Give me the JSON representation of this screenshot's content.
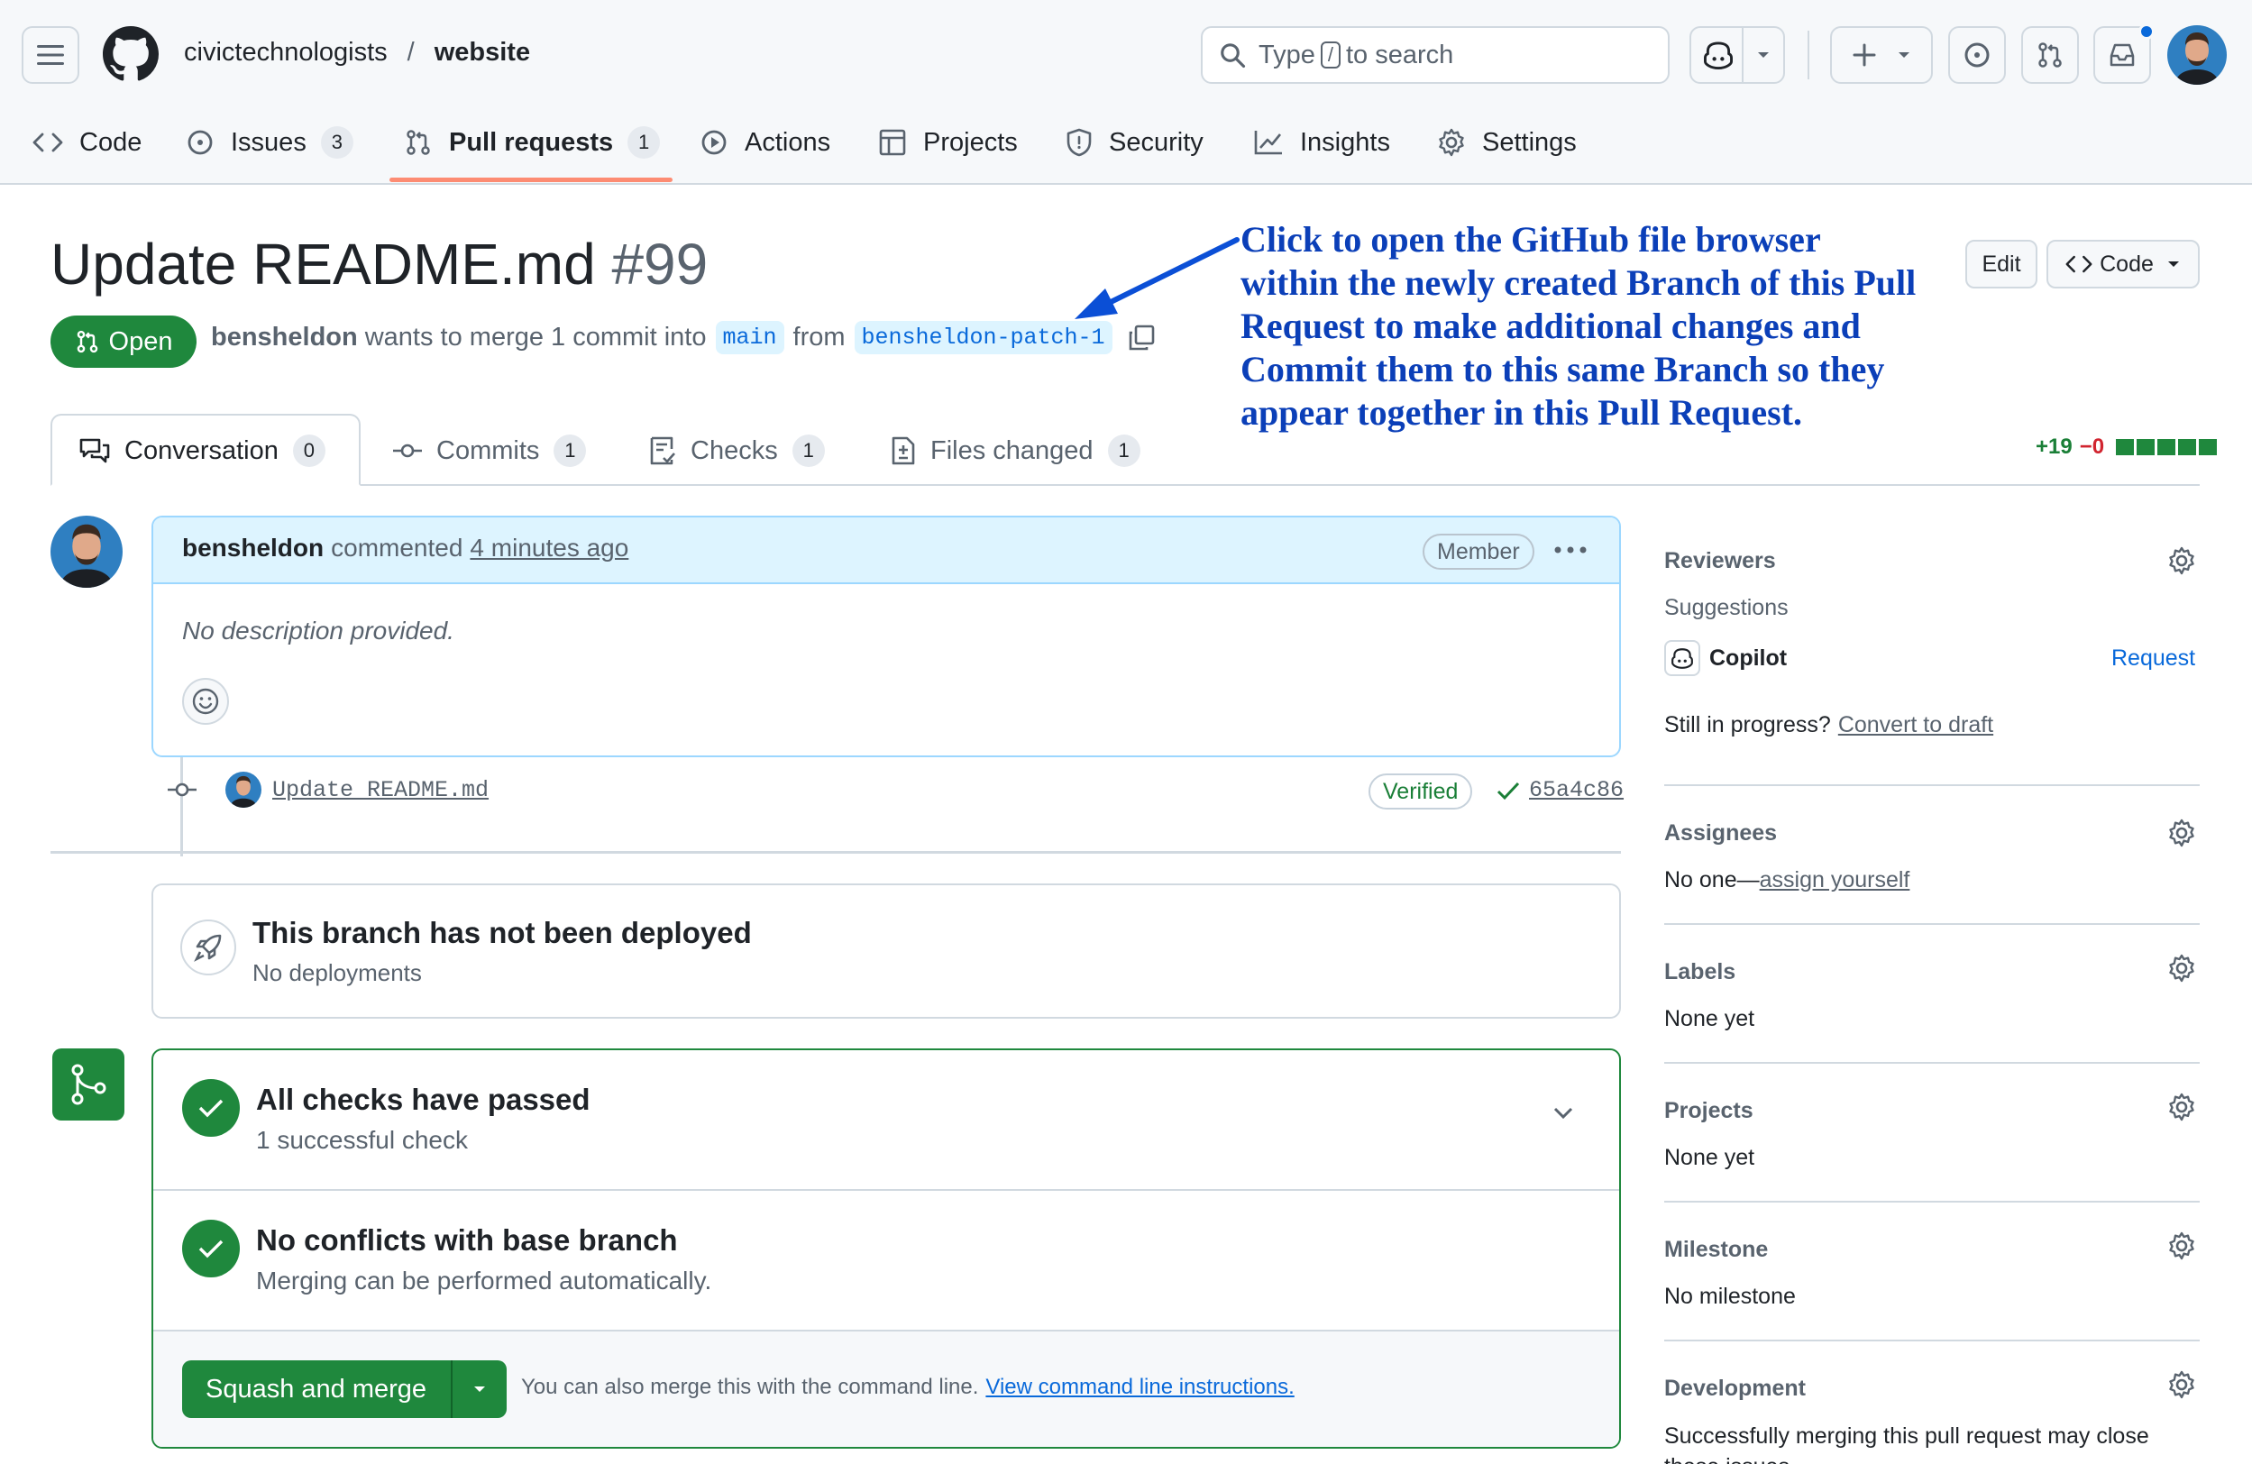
{
  "header": {
    "owner": "civictechnologists",
    "separator": "/",
    "repo": "website",
    "search": {
      "prefix": "Type",
      "key": "/",
      "suffix": "to search"
    }
  },
  "repo_nav": [
    {
      "label": "Code",
      "icon": "code-icon"
    },
    {
      "label": "Issues",
      "count": "3",
      "icon": "issue-icon"
    },
    {
      "label": "Pull requests",
      "count": "1",
      "icon": "pull-request-icon",
      "selected": true
    },
    {
      "label": "Actions",
      "icon": "play-icon"
    },
    {
      "label": "Projects",
      "icon": "table-icon"
    },
    {
      "label": "Security",
      "icon": "shield-icon"
    },
    {
      "label": "Insights",
      "icon": "graph-icon"
    },
    {
      "label": "Settings",
      "icon": "gear-icon"
    }
  ],
  "pr": {
    "title": "Update README.md",
    "number": "#99",
    "state": "Open",
    "author": "bensheldon",
    "merge_text": "wants to merge 1 commit into",
    "base": "main",
    "from_text": "from",
    "head": "bensheldon-patch-1",
    "edit_label": "Edit",
    "code_label": "Code"
  },
  "annotation": "Click to open the GitHub file browser within the newly created Branch of this Pull Request to make additional changes and Commit them to this same Branch so they appear together in this Pull Request.",
  "tabs": [
    {
      "label": "Conversation",
      "count": "0",
      "icon": "comment-discussion-icon"
    },
    {
      "label": "Commits",
      "count": "1",
      "icon": "git-commit-icon"
    },
    {
      "label": "Checks",
      "count": "1",
      "icon": "checklist-icon"
    },
    {
      "label": "Files changed",
      "count": "1",
      "icon": "file-diff-icon"
    }
  ],
  "diffstat": {
    "additions": "+19",
    "deletions": "−0"
  },
  "comment": {
    "author": "bensheldon",
    "action": "commented",
    "time": "4 minutes ago",
    "badge": "Member",
    "body": "No description provided."
  },
  "commit": {
    "message": "Update README.md",
    "verified": "Verified",
    "sha": "65a4c86"
  },
  "deploy": {
    "title": "This branch has not been deployed",
    "subtitle": "No deployments"
  },
  "merge": {
    "checks_title": "All checks have passed",
    "checks_sub": "1 successful check",
    "conflicts_title": "No conflicts with base branch",
    "conflicts_sub": "Merging can be performed automatically.",
    "button": "Squash and merge",
    "hint": "You can also merge this with the command line.",
    "hint_link": "View command line instructions."
  },
  "sidebar": {
    "reviewers_title": "Reviewers",
    "suggestions": "Suggestions",
    "copilot": "Copilot",
    "request": "Request",
    "draft_prefix": "Still in progress?",
    "draft_link": "Convert to draft",
    "assignees_title": "Assignees",
    "assignees_prefix": "No one—",
    "assignees_link": "assign yourself",
    "labels_title": "Labels",
    "labels_value": "None yet",
    "projects_title": "Projects",
    "projects_value": "None yet",
    "milestone_title": "Milestone",
    "milestone_value": "No milestone",
    "development_title": "Development",
    "development_value": "Successfully merging this pull request may close these issues."
  },
  "colors": {
    "green": "#1f883d",
    "blue_link": "#0969da",
    "annotation": "#0b3fb8",
    "accent_underline": "#fd8c73"
  }
}
